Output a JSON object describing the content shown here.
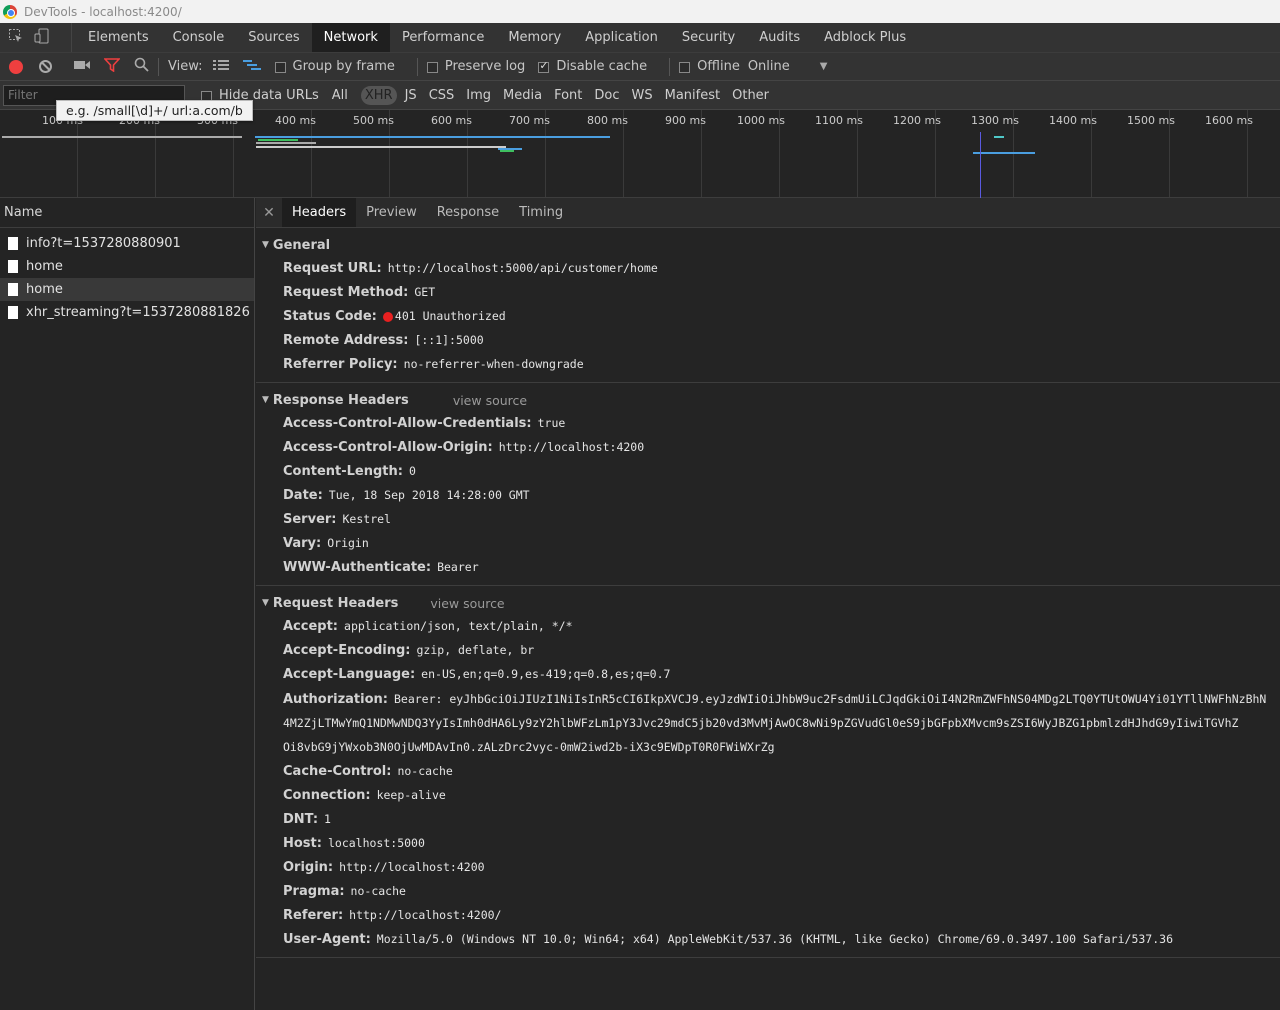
{
  "window": {
    "title": "DevTools - localhost:4200/"
  },
  "tabs": [
    "Elements",
    "Console",
    "Sources",
    "Network",
    "Performance",
    "Memory",
    "Application",
    "Security",
    "Audits",
    "Adblock Plus"
  ],
  "active_tab": "Network",
  "toolbar": {
    "view_label": "View:",
    "group_by_frame": "Group by frame",
    "preserve_log": "Preserve log",
    "disable_cache": "Disable cache",
    "offline": "Offline",
    "throttle": "Online"
  },
  "filter": {
    "placeholder": "Filter",
    "tooltip": "e.g. /small[\\d]+/ url:a.com/b",
    "hide_data_urls": "Hide data URLs",
    "types": [
      "All",
      "XHR",
      "JS",
      "CSS",
      "Img",
      "Media",
      "Font",
      "Doc",
      "WS",
      "Manifest",
      "Other"
    ],
    "active_type": "XHR"
  },
  "timeline": {
    "labels": [
      "100 ms",
      "200 ms",
      "300 ms",
      "400 ms",
      "500 ms",
      "600 ms",
      "700 ms",
      "800 ms",
      "900 ms",
      "1000 ms",
      "1100 ms",
      "1200 ms",
      "1300 ms",
      "1400 ms",
      "1500 ms",
      "1600 ms"
    ]
  },
  "requests": {
    "header": "Name",
    "items": [
      {
        "name": "info?t=1537280880901"
      },
      {
        "name": "home"
      },
      {
        "name": "home"
      },
      {
        "name": "xhr_streaming?t=1537280881826"
      }
    ]
  },
  "detail_tabs": [
    "Headers",
    "Preview",
    "Response",
    "Timing"
  ],
  "general": {
    "title": "General",
    "request_url_k": "Request URL:",
    "request_url_v": "http://localhost:5000/api/customer/home",
    "method_k": "Request Method:",
    "method_v": "GET",
    "status_k": "Status Code:",
    "status_v": "401 Unauthorized",
    "remote_k": "Remote Address:",
    "remote_v": "[::1]:5000",
    "referrer_k": "Referrer Policy:",
    "referrer_v": "no-referrer-when-downgrade"
  },
  "response_headers": {
    "title": "Response Headers",
    "view_source": "view source",
    "rows": [
      {
        "k": "Access-Control-Allow-Credentials:",
        "v": "true"
      },
      {
        "k": "Access-Control-Allow-Origin:",
        "v": "http://localhost:4200"
      },
      {
        "k": "Content-Length:",
        "v": "0"
      },
      {
        "k": "Date:",
        "v": "Tue, 18 Sep 2018 14:28:00 GMT"
      },
      {
        "k": "Server:",
        "v": "Kestrel"
      },
      {
        "k": "Vary:",
        "v": "Origin"
      },
      {
        "k": "WWW-Authenticate:",
        "v": "Bearer"
      }
    ]
  },
  "request_headers": {
    "title": "Request Headers",
    "view_source": "view source",
    "accept_k": "Accept:",
    "accept_v": "application/json, text/plain, */*",
    "encoding_k": "Accept-Encoding:",
    "encoding_v": "gzip, deflate, br",
    "language_k": "Accept-Language:",
    "language_v": "en-US,en;q=0.9,es-419;q=0.8,es;q=0.7",
    "auth_k": "Authorization:",
    "auth_v1": "Bearer: eyJhbGciOiJIUzI1NiIsInR5cCI6IkpXVCJ9.eyJzdWIiOiJhbW9uc2FsdmUiLCJqdGkiOiI4N2RmZWFhNS04MDg2LTQ0YTUtOWU4Yi01YTllNWFhNzBhN",
    "auth_v2": "4M2ZjLTMwYmQ1NDMwNDQ3YyIsImh0dHA6Ly9zY2hlbWFzLm1pY3Jvc29mdC5jb20vd3MvMjAwOC8wNi9pZGVudGl0eS9jbGFpbXMvcm9sZSI6WyJBZG1pbmlzdHJhdG9yIiwiTGVhZ",
    "auth_v3": "Oi8vbG9jYWxob3N0OjUwMDAvIn0.zALzDrc2vyc-0mW2iwd2b-iX3c9EWDpT0R0FWiWXrZg",
    "rows": [
      {
        "k": "Cache-Control:",
        "v": "no-cache"
      },
      {
        "k": "Connection:",
        "v": "keep-alive"
      },
      {
        "k": "DNT:",
        "v": "1"
      },
      {
        "k": "Host:",
        "v": "localhost:5000"
      },
      {
        "k": "Origin:",
        "v": "http://localhost:4200"
      },
      {
        "k": "Pragma:",
        "v": "no-cache"
      },
      {
        "k": "Referer:",
        "v": "http://localhost:4200/"
      },
      {
        "k": "User-Agent:",
        "v": "Mozilla/5.0 (Windows NT 10.0; Win64; x64) AppleWebKit/537.36 (KHTML, like Gecko) Chrome/69.0.3497.100 Safari/537.36"
      }
    ]
  },
  "colors": {
    "record": "#ef3f3f",
    "filter_active": "#ef3f3f",
    "status_dot": "#e82020"
  }
}
